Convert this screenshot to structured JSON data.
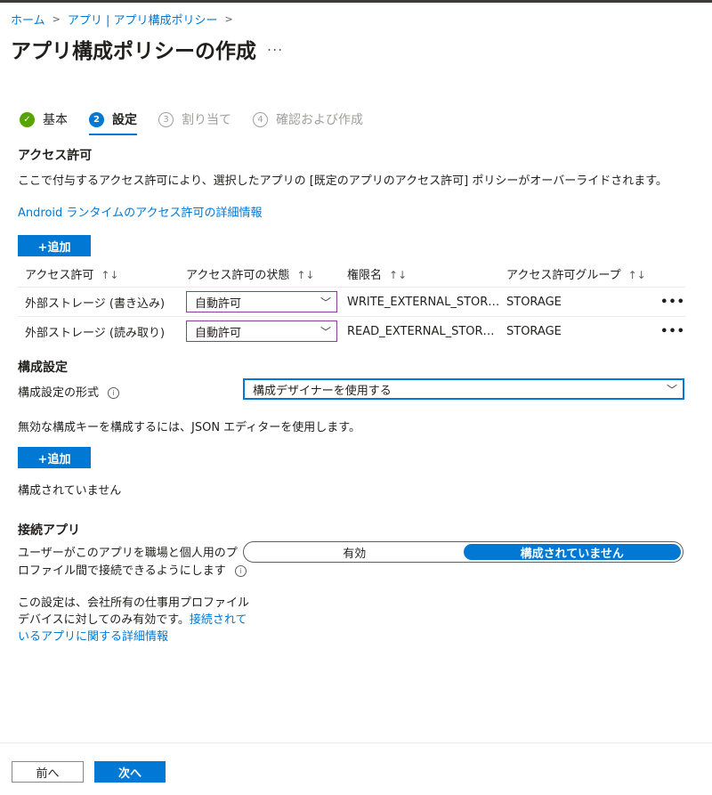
{
  "breadcrumb": {
    "home": "ホーム",
    "parent": "アプリ | アプリ構成ポリシー",
    "sep": ">"
  },
  "page": {
    "title": "アプリ構成ポリシーの作成",
    "more": "..."
  },
  "steps": [
    {
      "num": "✓",
      "label": "基本",
      "state": "done"
    },
    {
      "num": "2",
      "label": "設定",
      "state": "active"
    },
    {
      "num": "3",
      "label": "割り当て",
      "state": "pending"
    },
    {
      "num": "4",
      "label": "確認および作成",
      "state": "pending"
    }
  ],
  "permissions": {
    "heading": "アクセス許可",
    "description": "ここで付与するアクセス許可により、選択したアプリの [既定のアプリのアクセス許可] ポリシーがオーバーライドされます。",
    "learn_link": "Android ランタイムのアクセス許可の詳細情報",
    "add_label": "+追加",
    "columns": [
      "アクセス許可",
      "アクセス許可の状態",
      "権限名",
      "アクセス許可グループ"
    ],
    "sort_glyph": "↑↓",
    "rows": [
      {
        "permission": "外部ストレージ (書き込み)",
        "state": "自動許可",
        "name": "WRITE_EXTERNAL_STOR…",
        "group": "STORAGE",
        "more": "•••"
      },
      {
        "permission": "外部ストレージ (読み取り)",
        "state": "自動許可",
        "name": "READ_EXTERNAL_STOR…",
        "group": "STORAGE",
        "more": "•••"
      }
    ]
  },
  "config": {
    "heading": "構成設定",
    "format_label": "構成設定の形式",
    "format_value": "構成デザイナーを使用する",
    "json_note": "無効な構成キーを構成するには、JSON エディターを使用します。",
    "add_label": "+追加",
    "empty_text": "構成されていません"
  },
  "connected": {
    "heading": "接続アプリ",
    "label_line1": "ユーザーがこのアプリを職場と個人用のプ",
    "label_line2": "ロファイル間で接続できるようにします",
    "toggle_on": "有効",
    "toggle_off": "構成されていません",
    "selected": "構成されていません",
    "note_line1": "この設定は、会社所有の仕事用プロファイル",
    "note_line2": "デバイスに対してのみ有効です。",
    "note_link1": "接続されて",
    "note_link2": "いるアプリに関する詳細情報"
  },
  "footer": {
    "prev": "前へ",
    "next": "次へ"
  },
  "icons": {
    "info": "i",
    "chevron": "﹀",
    "check": "✓"
  },
  "colors": {
    "accent": "#0078d4",
    "success": "#57a300",
    "select_border": "#8a3d9e"
  }
}
